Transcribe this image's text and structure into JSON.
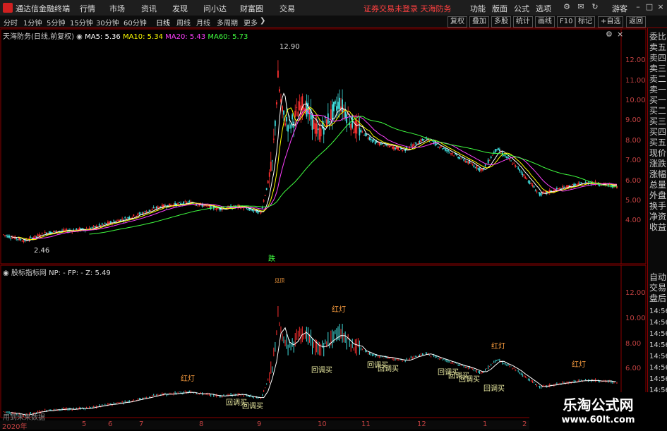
{
  "app": {
    "title": "通达信金融终端",
    "status_text": "证券交易未登录  天海防务",
    "guest": "游客"
  },
  "menu": [
    "行情",
    "市场",
    "资讯",
    "发现",
    "问小达",
    "财富圈",
    "交易"
  ],
  "right_menu": [
    "功能",
    "版面",
    "公式",
    "选项"
  ],
  "toolbar": {
    "periods": [
      "分时",
      "1分钟",
      "5分钟",
      "15分钟",
      "30分钟",
      "60分钟",
      "日线",
      "周线",
      "月线",
      "多周期",
      "更多"
    ],
    "active": "日线",
    "right_buttons": [
      "复权",
      "叠加",
      "多股",
      "统计",
      "画线",
      "F10",
      "标记",
      "+自选",
      "返回"
    ]
  },
  "main_chart": {
    "title": "天海防务(日线,前复权)",
    "ma": [
      {
        "label": "MA5: 5.36",
        "color": "#ffffff"
      },
      {
        "label": "MA10: 5.34",
        "color": "#ffff00"
      },
      {
        "label": "MA20: 5.43",
        "color": "#ff40ff"
      },
      {
        "label": "MA60: 5.73",
        "color": "#40ff40"
      }
    ],
    "high_label": "12.90",
    "low_label": "2.46",
    "event_tag": "跌",
    "y_ticks": [
      "12.00",
      "11.00",
      "10.00",
      "9.00",
      "8.00",
      "7.00",
      "6.00",
      "5.00",
      "4.00"
    ]
  },
  "sub_chart": {
    "title": "股标指标网",
    "params": "NP: -  FP: -  Z: 5.49",
    "y_ticks": [
      "12.00",
      "10.00",
      "8.00",
      "6.00"
    ],
    "red_signal": "红灯",
    "buy_signal": "回调买",
    "top_label": "见顶",
    "note": "用到未来数据"
  },
  "x_axis": [
    "2020年",
    "5",
    "6",
    "7",
    "8",
    "9",
    "10",
    "11",
    "12",
    "1",
    "2"
  ],
  "sidebar": {
    "items": [
      "委比",
      "卖五",
      "卖四",
      "卖三",
      "卖二",
      "卖一",
      "买一",
      "买二",
      "买三",
      "买四",
      "买五",
      "现价",
      "涨跌",
      "涨幅",
      "总量",
      "外盘",
      "换手",
      "净资",
      "收益",
      "自动",
      "交易",
      "盘后"
    ],
    "times": [
      "14:56",
      "14:56",
      "14:56",
      "14:56",
      "14:56",
      "14:56",
      "14:56",
      "14:56"
    ]
  },
  "watermark": {
    "line1": "乐淘公式网",
    "line2": "www.60lt.com"
  },
  "colors": {
    "up": "#ff3030",
    "down": "#40e0e0",
    "grid": "#8b0000",
    "ma5": "#ffffff",
    "ma10": "#ffff00",
    "ma20": "#ff40ff",
    "ma60": "#40ff40"
  }
}
